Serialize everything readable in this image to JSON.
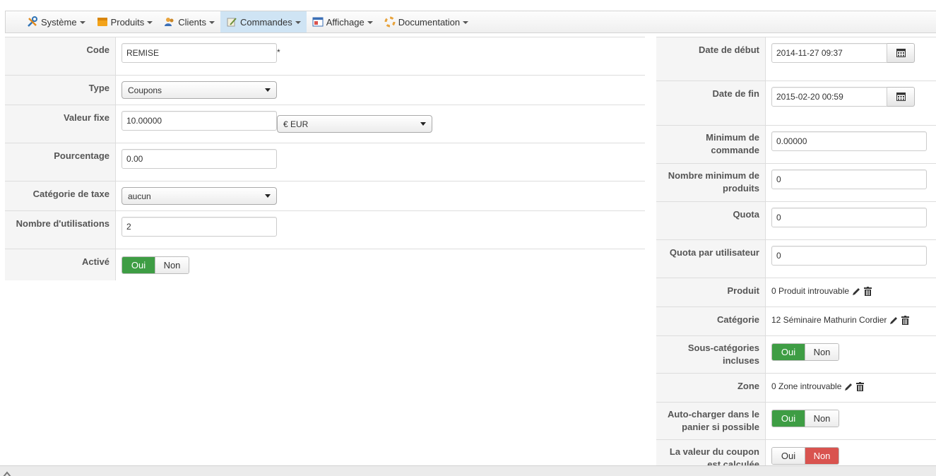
{
  "menu": [
    {
      "label": "Système",
      "icon": "wrench-screwdriver-icon"
    },
    {
      "label": "Produits",
      "icon": "product-box-icon"
    },
    {
      "label": "Clients",
      "icon": "clients-users-icon"
    },
    {
      "label": "Commandes",
      "icon": "orders-pen-icon"
    },
    {
      "label": "Affichage",
      "icon": "display-window-icon"
    },
    {
      "label": "Documentation",
      "icon": "documentation-lifebuoy-icon"
    }
  ],
  "left_form": {
    "code": {
      "label": "Code",
      "value": "REMISE",
      "required": "*"
    },
    "type": {
      "label": "Type",
      "value": "Coupons"
    },
    "fixed_value": {
      "label": "Valeur fixe",
      "value": "10.00000",
      "currency": "€ EUR"
    },
    "percentage": {
      "label": "Pourcentage",
      "value": "0.00"
    },
    "tax_category": {
      "label": "Catégorie de taxe",
      "value": "aucun"
    },
    "usage_count": {
      "label": "Nombre d'utilisations",
      "value": "2"
    },
    "active": {
      "label": "Activé",
      "yes": "Oui",
      "no": "Non",
      "selected": "Oui"
    }
  },
  "right_form": {
    "start_date": {
      "label": "Date de début",
      "value": "2014-11-27 09:37"
    },
    "end_date": {
      "label": "Date de fin",
      "value": "2015-02-20 00:59"
    },
    "min_order": {
      "label": "Minimum de commande",
      "value": "0.00000"
    },
    "min_products": {
      "label": "Nombre minimum de produits",
      "value": "0"
    },
    "quota": {
      "label": "Quota",
      "value": "0"
    },
    "quota_per_user": {
      "label": "Quota par utilisateur",
      "value": "0"
    },
    "product": {
      "label": "Produit",
      "value": "0 Produit introuvable"
    },
    "category": {
      "label": "Catégorie",
      "value": "12 Séminaire Mathurin Cordier"
    },
    "subcategories": {
      "label": "Sous-catégories incluses",
      "yes": "Oui",
      "no": "Non",
      "selected": "Oui"
    },
    "zone": {
      "label": "Zone",
      "value": "0 Zone introuvable"
    },
    "autoload": {
      "label": "Auto-charger dans le panier si possible",
      "yes": "Oui",
      "no": "Non",
      "selected": "Oui"
    },
    "coupon_value": {
      "label": "La valeur du coupon est calculée",
      "yes": "Oui",
      "no": "Non",
      "selected": "Non"
    }
  },
  "colors": {
    "menu_active_bg": "#cfe4f4",
    "toggle_yes_active": "#3e9d44",
    "toggle_no_active": "#d9534f"
  }
}
